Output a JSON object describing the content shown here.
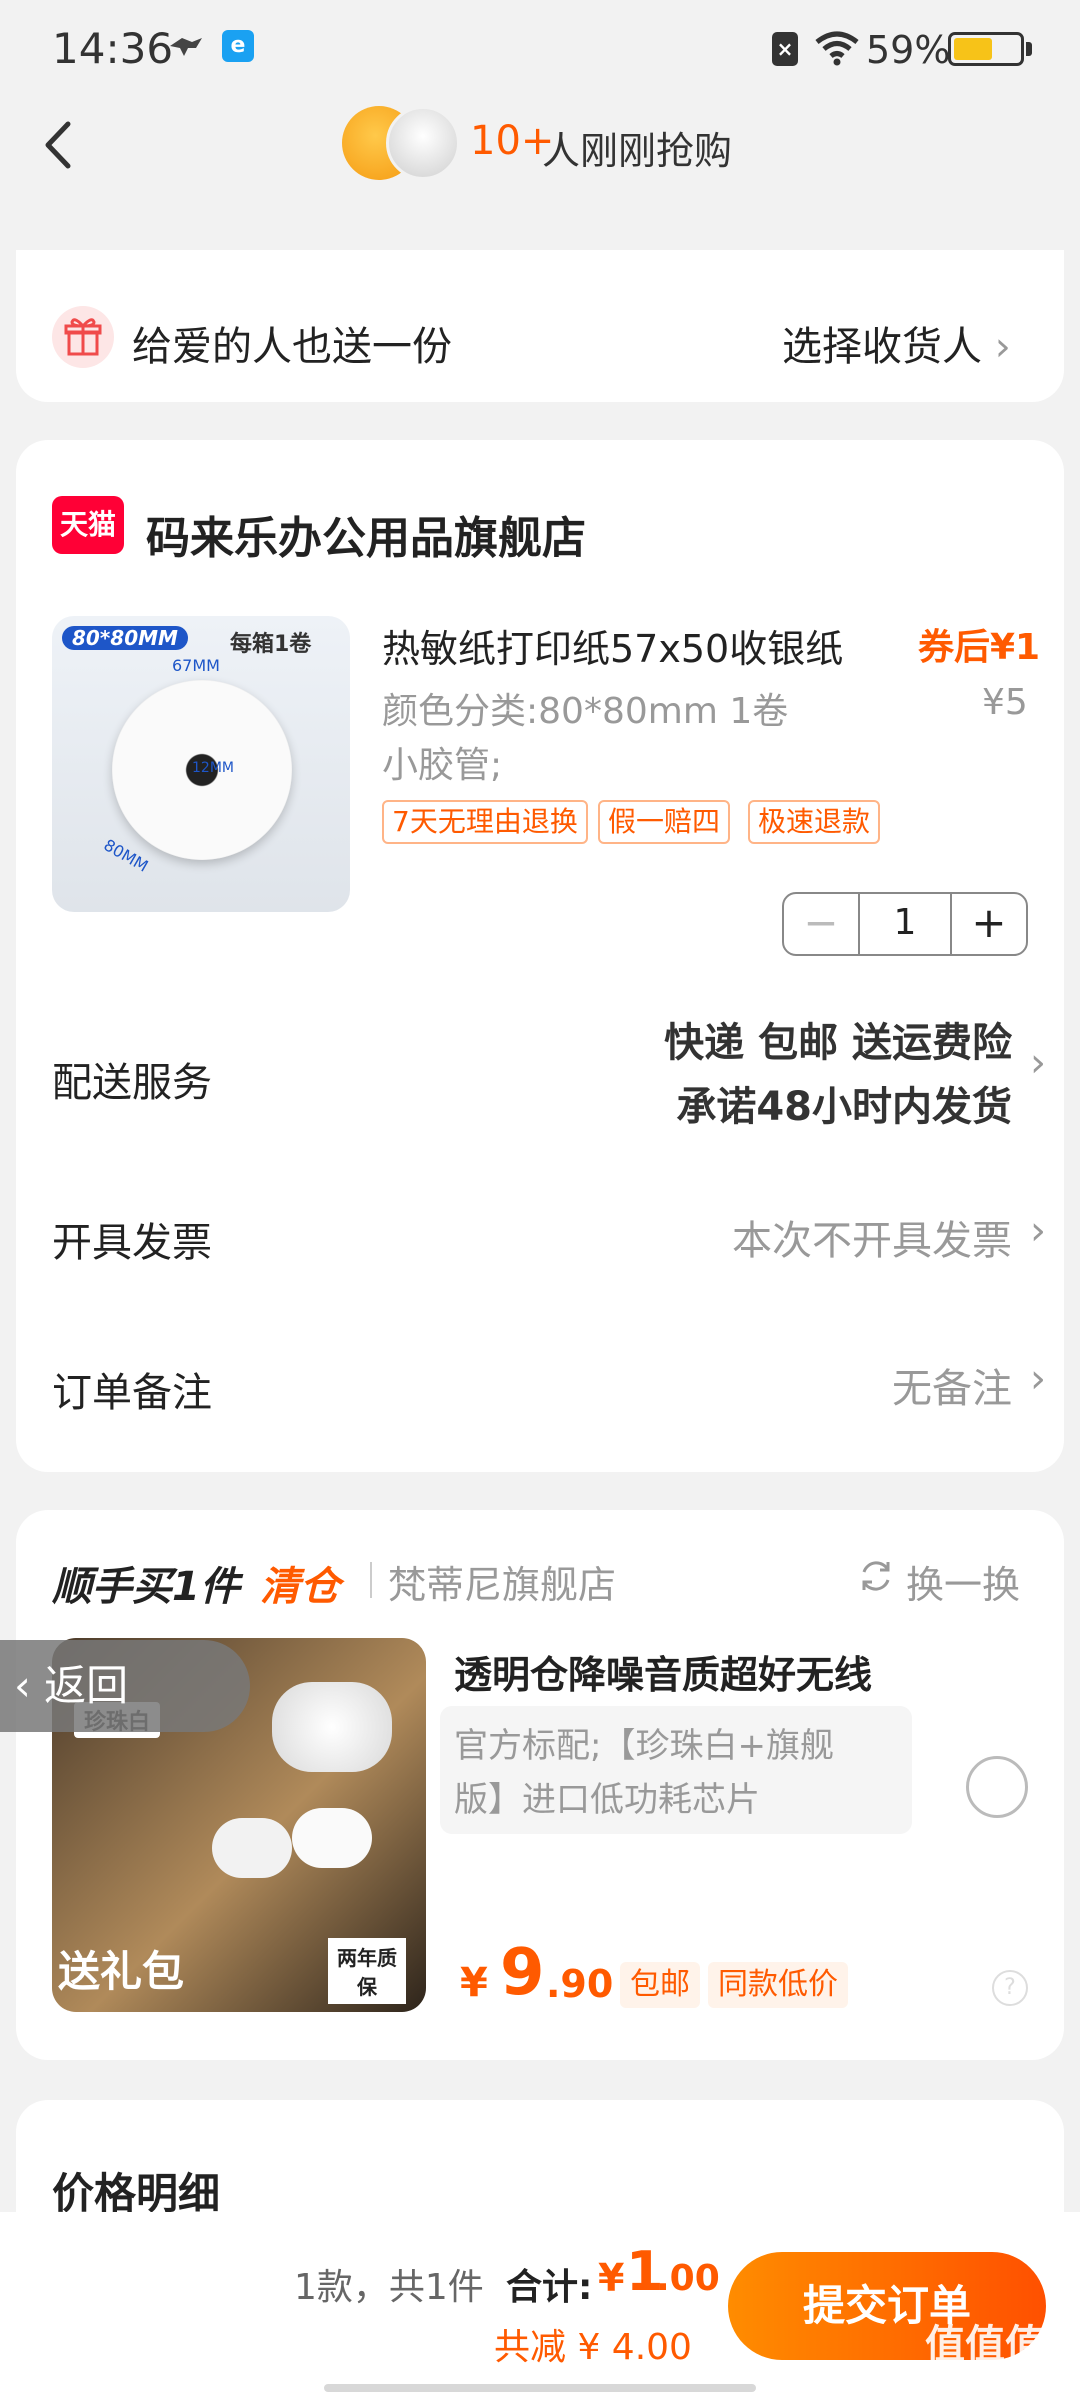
{
  "status_bar": {
    "time": "14:36",
    "battery": "59%",
    "battery_level": 0.59
  },
  "header": {
    "rush_count": "10+",
    "rush_text": "人刚刚抢购"
  },
  "gift": {
    "text": "给爱的人也送一份",
    "action": "选择收货人"
  },
  "order": {
    "shop_badge": "天猫",
    "shop_name": "码来乐办公用品旗舰店",
    "product": {
      "title": "热敏纸打印纸57x50收银纸",
      "price_after_coupon": "券后¥1",
      "spec_line1": "颜色分类:80*80mm 1卷",
      "spec_line2": "小胶管;",
      "original_price": "¥5",
      "tags": [
        "7天无理由退换",
        "假一赔四",
        "极速退款"
      ],
      "image_labels": {
        "size": "80*80MM",
        "per_box": "每箱1卷",
        "width": "67MM",
        "core": "12MM",
        "diameter": "80MM"
      },
      "quantity": "1"
    },
    "delivery": {
      "label": "配送服务",
      "line1": "快递 包邮 送运费险",
      "line2": "承诺48小时内发货"
    },
    "invoice": {
      "label": "开具发票",
      "value": "本次不开具发票"
    },
    "note": {
      "label": "订单备注",
      "value": "无备注"
    }
  },
  "addon": {
    "title": "顺手买1件",
    "clearance": "清仓",
    "shop": "梵蒂尼旗舰店",
    "swap": "换一换",
    "back_label": "返回",
    "name": "透明仓降噪音质超好无线",
    "spec_line1": "官方标配;【珍珠白+旗舰",
    "spec_line2": "版】进口低功耗芯片",
    "price_symbol": "¥",
    "price_int": "9",
    "price_dec": ".90",
    "tags": [
      "包邮",
      "同款低价"
    ],
    "image_labels": {
      "color": "珍珠白",
      "gift": "送礼包",
      "warranty": "两年质保"
    }
  },
  "price_detail": {
    "title": "价格明细"
  },
  "bottom": {
    "count": "1款，共1件",
    "total_label": "合计:",
    "total_symbol": "¥",
    "total_int": "1",
    "total_dec": ".00",
    "discount": "共减 ¥ 4.00",
    "submit": "提交订单"
  },
  "watermark": "值值值",
  "colors": {
    "accent": "#ff5a00",
    "tmall": "#ff0036",
    "battery": "#f7c318"
  }
}
